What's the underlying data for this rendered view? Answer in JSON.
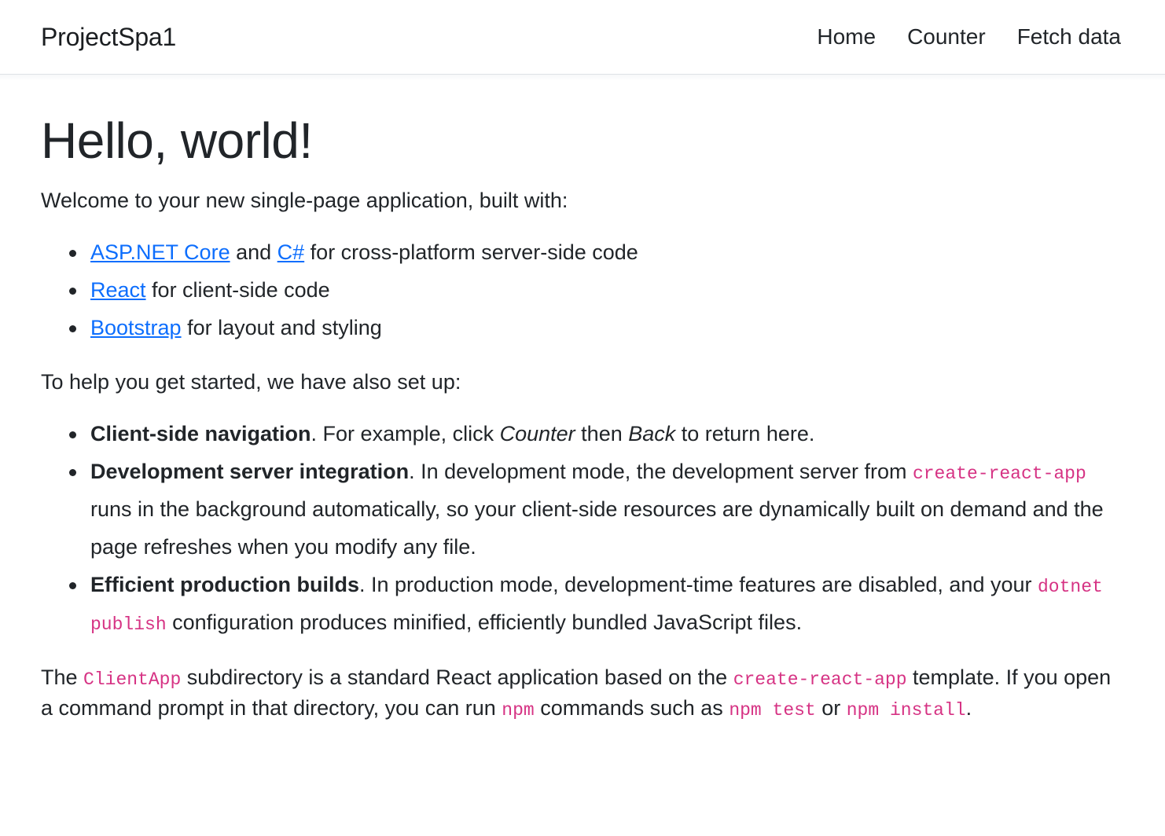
{
  "navbar": {
    "brand": "ProjectSpa1",
    "links": [
      {
        "label": "Home"
      },
      {
        "label": "Counter"
      },
      {
        "label": "Fetch data"
      }
    ]
  },
  "main": {
    "title": "Hello, world!",
    "intro": "Welcome to your new single-page application, built with:",
    "built_with": {
      "item1": {
        "link1": "ASP.NET Core",
        "mid": " and ",
        "link2": "C#",
        "tail": " for cross-platform server-side code"
      },
      "item2": {
        "link": "React",
        "tail": " for client-side code"
      },
      "item3": {
        "link": "Bootstrap",
        "tail": " for layout and styling"
      }
    },
    "setup_intro": "To help you get started, we have also set up:",
    "features": {
      "nav": {
        "bold": "Client-side navigation",
        "part1": ". For example, click ",
        "em1": "Counter",
        "part2": " then ",
        "em2": "Back",
        "part3": " to return here."
      },
      "devserver": {
        "bold": "Development server integration",
        "part1": ". In development mode, the development server from ",
        "code": "create-react-app",
        "part2": " runs in the background automatically, so your client-side resources are dynamically built on demand and the page refreshes when you modify any file."
      },
      "prodbuilds": {
        "bold": "Efficient production builds",
        "part1": ". In production mode, development-time features are disabled, and your ",
        "code": "dotnet publish",
        "part2": " configuration produces minified, efficiently bundled JavaScript files."
      }
    },
    "closing": {
      "part1": "The ",
      "code1": "ClientApp",
      "part2": " subdirectory is a standard React application based on the ",
      "code2": "create-react-app",
      "part3": " template. If you open a command prompt in that directory, you can run ",
      "code3": "npm",
      "part4": " commands such as ",
      "code4": "npm test",
      "part5": " or ",
      "code5": "npm install",
      "part6": "."
    }
  },
  "colors": {
    "link": "#0d6efd",
    "code": "#d63384",
    "text": "#212529",
    "border": "#dee2e6",
    "background": "#ffffff"
  }
}
